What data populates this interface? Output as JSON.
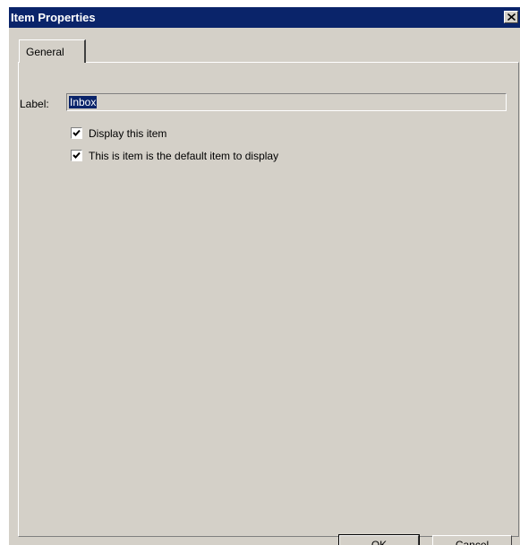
{
  "window": {
    "title": "Item Properties",
    "close_glyph": "✕"
  },
  "tabs": [
    {
      "label": "General",
      "selected": true
    }
  ],
  "general": {
    "label_caption": "Label:",
    "label_value": "Inbox",
    "checkboxes": [
      {
        "label": "Display this item",
        "checked": true
      },
      {
        "label": "This is item is the default item to display",
        "checked": true
      }
    ]
  },
  "buttons": {
    "ok_label": "OK",
    "cancel_label": "Cancel"
  },
  "colors": {
    "titlebar": "#0a246a",
    "dialog_face": "#d4d0c8",
    "selection": "#0a246a"
  },
  "icons": {
    "close": "close-icon",
    "check": "checkmark-icon"
  }
}
